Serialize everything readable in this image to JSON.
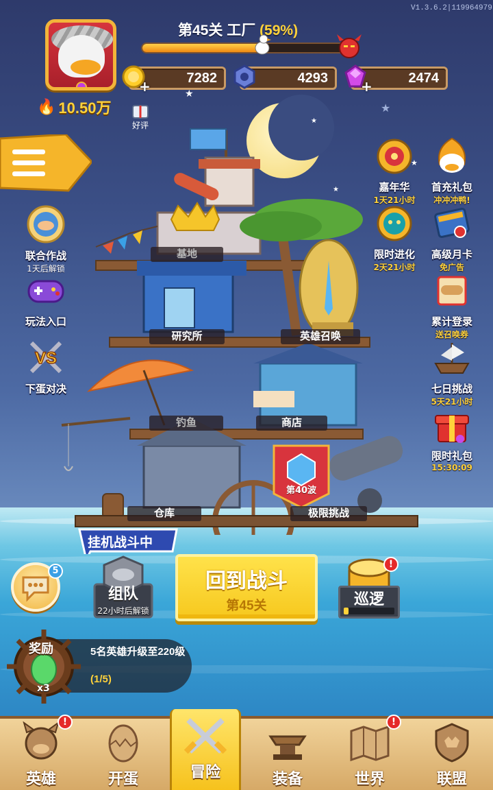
{
  "version": "V1.3.6.2|119964979",
  "header": {
    "level_title": "第45关 工厂",
    "level_progress_text": "(59%)",
    "level_progress": 0.59,
    "power": "10.50万",
    "resources": [
      {
        "name": "gold",
        "value": "7282",
        "icon": "gold-coin-icon",
        "has_plus": true
      },
      {
        "name": "gear",
        "value": "4293",
        "icon": "gear-token-icon",
        "has_plus": false
      },
      {
        "name": "gem",
        "value": "2474",
        "icon": "purple-gem-icon",
        "has_plus": true
      }
    ],
    "rate_label": "好评"
  },
  "left_menu": [
    {
      "label": "联合作战",
      "sub": "1天后解锁",
      "icon": "handshake-shield-icon"
    },
    {
      "label": "玩法入口",
      "sub": "",
      "icon": "gamepad-icon"
    },
    {
      "label": "下蛋对决",
      "sub": "",
      "icon": "versus-icon"
    }
  ],
  "right_menu": [
    {
      "label": "嘉年华",
      "sub": "1天21小时",
      "icon": "carnival-wheel-icon"
    },
    {
      "label": "首充礼包",
      "sub": "冲冲冲鸭!",
      "icon": "first-charge-duck-icon"
    },
    {
      "label": "限时进化",
      "sub": "2天21小时",
      "icon": "evolution-icon"
    },
    {
      "label": "高级月卡",
      "sub": "免广告",
      "icon": "month-card-icon"
    },
    {
      "label": "累计登录",
      "sub": "送召唤券",
      "icon": "login-scroll-icon"
    },
    {
      "label": "七日挑战",
      "sub": "5天21小时",
      "icon": "pirate-ship-icon"
    },
    {
      "label": "限时礼包",
      "sub": "15:30:09",
      "icon": "gift-box-icon"
    }
  ],
  "buildings": {
    "base": "基地",
    "research": "研究所",
    "summon": "英雄召唤",
    "fishing": "钓鱼",
    "shop": "商店",
    "warehouse": "仓库",
    "challenge": "极限挑战",
    "wave_badge": "第40波"
  },
  "actions": {
    "idle_status": "挂机战斗中",
    "chat_badge": "5",
    "team_label": "组队",
    "team_sub": "22小时后解锁",
    "return_label": "回到战斗",
    "return_sub": "第45关",
    "patrol_label": "巡逻",
    "patrol_progress": 0.1,
    "alert": "!"
  },
  "reward": {
    "title": "奖励",
    "qty": "x3",
    "desc": "5名英雄升级至220级",
    "progress": "(1/5)"
  },
  "nav": [
    {
      "label": "英雄",
      "icon": "hero-icon",
      "active": false,
      "alert": true
    },
    {
      "label": "开蛋",
      "icon": "egg-icon",
      "active": false,
      "alert": false
    },
    {
      "label": "冒险",
      "icon": "crossed-swords-icon",
      "active": true,
      "alert": false
    },
    {
      "label": "装备",
      "icon": "anvil-icon",
      "active": false,
      "alert": false
    },
    {
      "label": "世界",
      "icon": "world-map-icon",
      "active": false,
      "alert": true
    },
    {
      "label": "联盟",
      "icon": "alliance-shield-icon",
      "active": false,
      "alert": false
    }
  ]
}
